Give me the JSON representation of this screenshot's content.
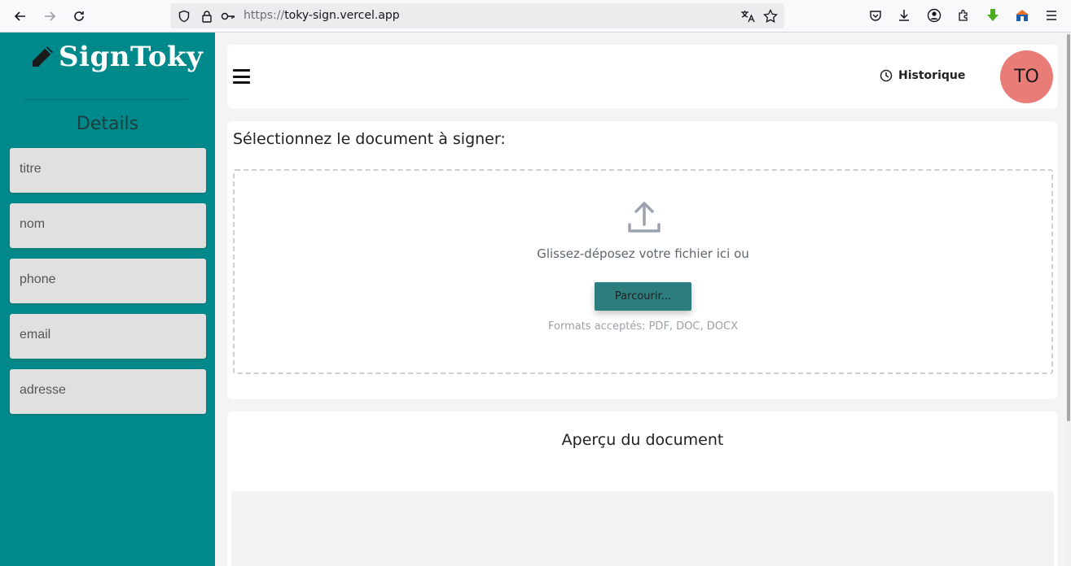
{
  "browser": {
    "url_scheme": "https://",
    "url_host": "toky-sign.vercel.app"
  },
  "sidebar": {
    "logo_text": "SignToky",
    "details_title": "Details",
    "fields": [
      {
        "placeholder": "titre"
      },
      {
        "placeholder": "nom"
      },
      {
        "placeholder": "phone"
      },
      {
        "placeholder": "email"
      },
      {
        "placeholder": "adresse"
      }
    ]
  },
  "header": {
    "history_label": "Historique",
    "avatar_initials": "TO"
  },
  "upload": {
    "title": "Sélectionnez le document à signer:",
    "drop_text": "Glissez-déposez votre fichier ici ou",
    "browse_label": "Parcourir...",
    "formats_text": "Formats acceptés: PDF, DOC, DOCX"
  },
  "preview": {
    "title": "Aperçu du document"
  },
  "colors": {
    "sidebar_bg": "#00898a",
    "avatar_bg": "#ea7c78",
    "button_bg": "#2e7d7e"
  }
}
